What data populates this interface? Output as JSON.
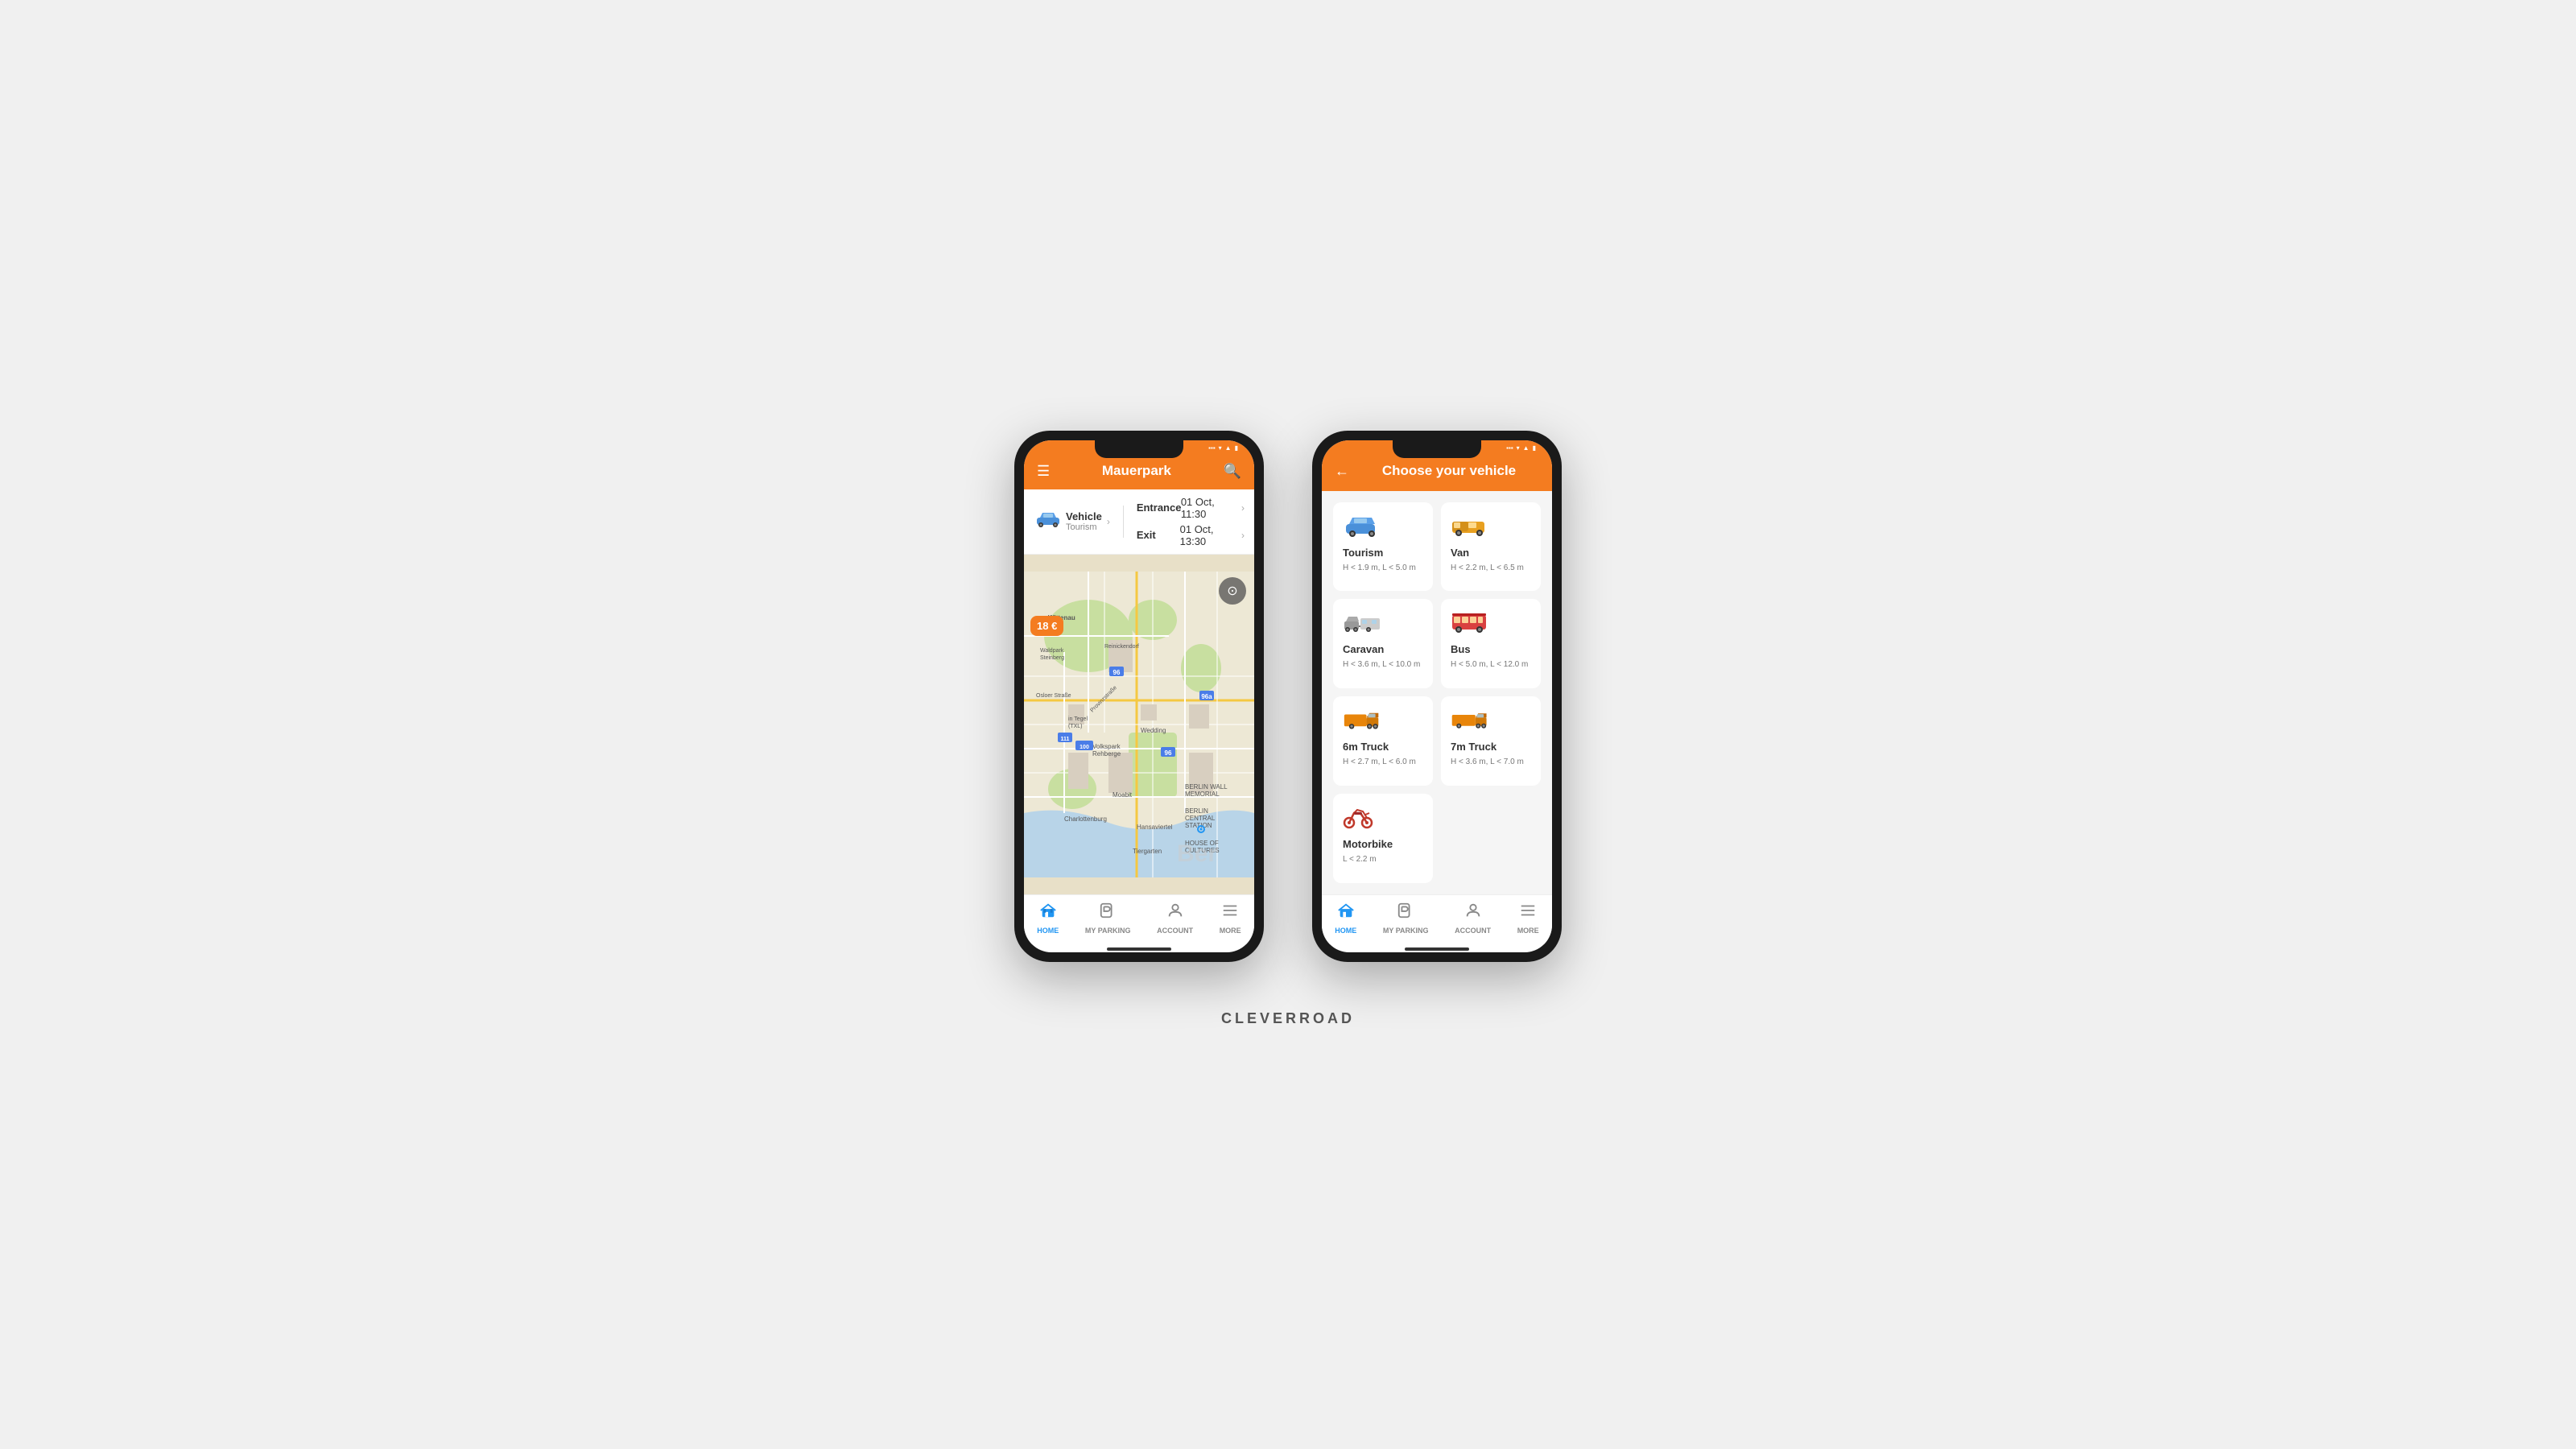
{
  "brand": "CLEVERROAD",
  "phone1": {
    "header": {
      "menu_icon": "☰",
      "title": "Mauerpark",
      "search_icon": "🔍"
    },
    "vehicle_bar": {
      "vehicle_icon": "🚗",
      "vehicle_label": "Vehicle",
      "vehicle_sub": "Tourism",
      "vehicle_arrow": "›",
      "entrance_label": "Entrance",
      "entrance_time": "01 Oct, 11:30",
      "exit_label": "Exit",
      "exit_time": "01 Oct, 13:30"
    },
    "price_badge": "18 €",
    "nav": {
      "items": [
        {
          "icon": "🅿",
          "label": "HOME",
          "active": true
        },
        {
          "icon": "🎫",
          "label": "MY PARKING",
          "active": false
        },
        {
          "icon": "👤",
          "label": "ACCOUNT",
          "active": false
        },
        {
          "icon": "☰",
          "label": "MORE",
          "active": false
        }
      ]
    }
  },
  "phone2": {
    "header": {
      "back_icon": "←",
      "title": "Choose your vehicle"
    },
    "vehicles": [
      {
        "id": "tourism",
        "name": "Tourism",
        "dims": "H < 1.9 m, L < 5.0 m",
        "icon": "car"
      },
      {
        "id": "van",
        "name": "Van",
        "dims": "H < 2.2 m, L < 6.5 m",
        "icon": "van"
      },
      {
        "id": "caravan",
        "name": "Caravan",
        "dims": "H < 3.6 m, L < 10.0 m",
        "icon": "caravan"
      },
      {
        "id": "bus",
        "name": "Bus",
        "dims": "H < 5.0 m, L < 12.0 m",
        "icon": "bus"
      },
      {
        "id": "truck6",
        "name": "6m Truck",
        "dims": "H < 2.7 m, L < 6.0 m",
        "icon": "truck6"
      },
      {
        "id": "truck7",
        "name": "7m Truck",
        "dims": "H < 3.6 m, L < 7.0 m",
        "icon": "truck7"
      },
      {
        "id": "motorbike",
        "name": "Motorbike",
        "dims": "L < 2.2 m",
        "icon": "moto"
      }
    ],
    "nav": {
      "items": [
        {
          "icon": "🏠",
          "label": "HOME",
          "active": true
        },
        {
          "icon": "🎫",
          "label": "MY PARKING",
          "active": false
        },
        {
          "icon": "👤",
          "label": "ACCOUNT",
          "active": false
        },
        {
          "icon": "☰",
          "label": "MORE",
          "active": false
        }
      ]
    }
  }
}
